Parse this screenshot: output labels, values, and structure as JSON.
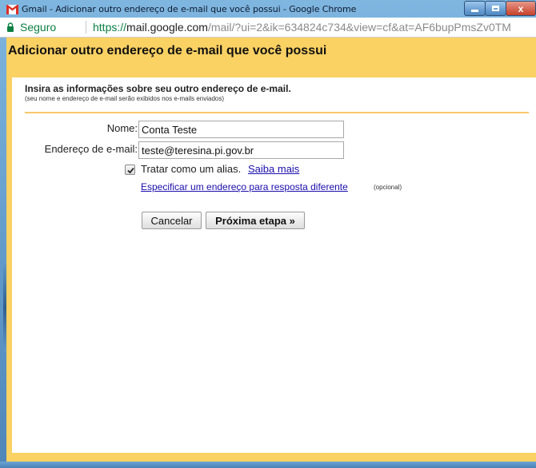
{
  "window": {
    "title": "Gmail - Adicionar outro endereço de e-mail que você possui - Google Chrome",
    "controls": {
      "minimize": "minimize",
      "maximize": "maximize",
      "close": "x"
    }
  },
  "addressbar": {
    "secure_label": "Seguro",
    "url_scheme": "https://",
    "url_host": "mail.google.com",
    "url_path": "/mail/?ui=2&ik=634824c734&view=cf&at=AF6bupPmsZv0TM"
  },
  "page": {
    "title": "Adicionar outro endereço de e-mail que você possui",
    "section_heading": "Insira as informações sobre seu outro endereço de e-mail.",
    "section_subtext": "(seu nome e endereço de e-mail serão exibidos nos e-mails enviados)"
  },
  "form": {
    "name_label": "Nome:",
    "name_value": "Conta Teste",
    "email_label": "Endereço de e-mail:",
    "email_value": "teste@teresina.pi.gov.br",
    "alias_checked": true,
    "alias_label": "Tratar como um alias.",
    "learn_more": "Saiba mais",
    "reply_to_link": "Especificar um endereço para resposta diferente",
    "optional_note": "(opcional)"
  },
  "buttons": {
    "cancel": "Cancelar",
    "next": "Próxima etapa »"
  },
  "colors": {
    "header_yellow": "#fad163",
    "link_blue": "#1a0dab",
    "secure_green": "#0b8043"
  }
}
